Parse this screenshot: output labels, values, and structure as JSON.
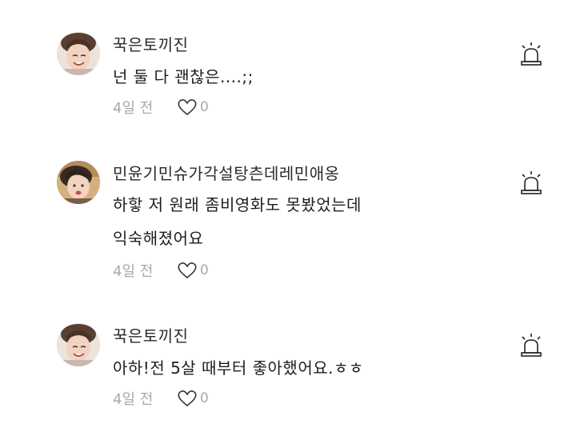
{
  "comments": [
    {
      "username": "꾹은토끼진",
      "lines": [
        "넌 둘 다 괜찮은....;;",
        ""
      ],
      "time": "4일 전",
      "likes": "0",
      "avatar_icon": "user-avatar-photo"
    },
    {
      "username": "민윤기민슈가각설탕츤데레민애옹",
      "lines": [
        "하핳 저 원래 좀비영화도 못봤었는데",
        "익숙해졌어요"
      ],
      "time": "4일 전",
      "likes": "0",
      "avatar_icon": "user-avatar-photo"
    },
    {
      "username": "꾹은토끼진",
      "lines": [
        "아하!전 5살 때부터 좋아했어요.ㅎㅎ",
        ""
      ],
      "time": "4일 전",
      "likes": "0",
      "avatar_icon": "user-avatar-photo"
    }
  ],
  "icons": {
    "like": "heart-outline-icon",
    "report": "siren-alarm-icon"
  },
  "colors": {
    "text": "#1e1e1e",
    "meta": "#a9a9a9",
    "icon": "#222222"
  }
}
